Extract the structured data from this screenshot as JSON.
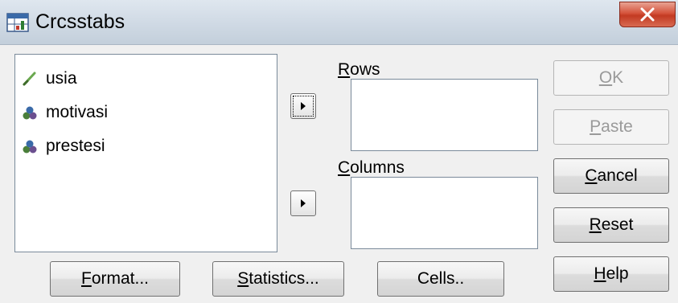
{
  "window": {
    "title": "Crosstabs",
    "title_display": "Crcsstabs"
  },
  "variables": [
    {
      "name": "usia",
      "icon": "scale-variable-icon"
    },
    {
      "name": "motivasi",
      "icon": "ordinal-variable-icon"
    },
    {
      "name": "prestesi",
      "icon": "ordinal-variable-icon"
    }
  ],
  "rows": {
    "mnemonic": "R",
    "rest": "ows"
  },
  "columns": {
    "mnemonic": "C",
    "rest": "olumns"
  },
  "side_buttons": {
    "ok": {
      "mnemonic": "O",
      "rest": "K",
      "enabled": false
    },
    "paste": {
      "mnemonic": "P",
      "rest": "aste",
      "enabled": false
    },
    "cancel": {
      "mnemonic": "C",
      "rest": "ancel",
      "enabled": true
    },
    "reset": {
      "mnemonic": "R",
      "rest": "eset",
      "enabled": true
    },
    "help": {
      "mnemonic": "H",
      "rest": "elp",
      "enabled": true
    }
  },
  "bottom_buttons": {
    "format": {
      "mnemonic": "F",
      "rest": "ormat..."
    },
    "statistics": {
      "mnemonic": "S",
      "rest": "tatistics..."
    },
    "cells": {
      "label": "Cells.."
    }
  },
  "colors": {
    "close_button": "#c23a22",
    "scale_icon": "#6aa84f",
    "ordinal_icon": "#4a7f3a"
  }
}
